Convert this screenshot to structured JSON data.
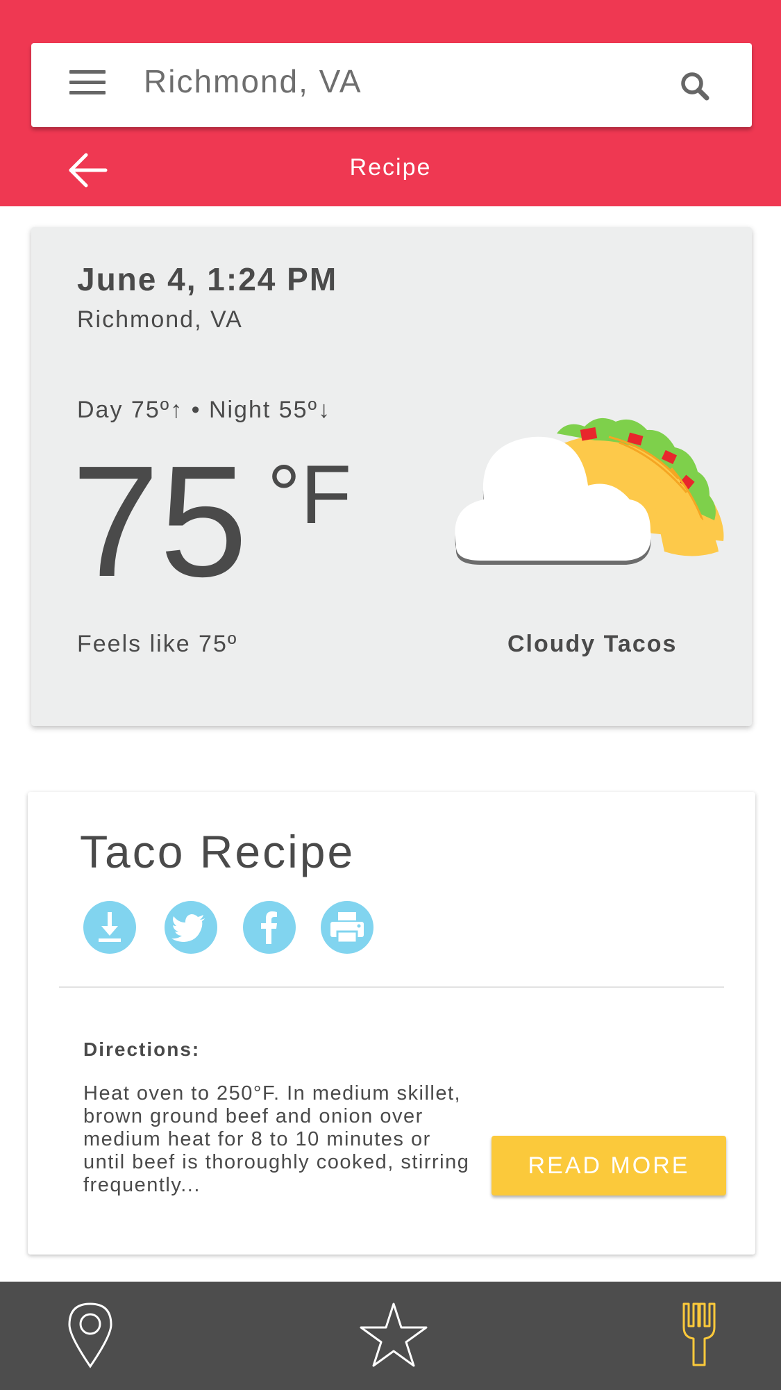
{
  "header": {
    "search_value": "Richmond, VA",
    "title": "Recipe",
    "background_color": "#ef3852",
    "icons": {
      "menu": "menu-icon",
      "search": "search-icon",
      "back": "back-arrow-icon"
    }
  },
  "weather": {
    "datetime": "June 4, 1:24 PM",
    "location": "Richmond, VA",
    "day_night": "Day 75º↑ • Night 55º↓",
    "temperature": "75",
    "unit": "°F",
    "feels_like": "Feels like 75º",
    "condition": "Cloudy Tacos",
    "illustration": "cloudy-taco-icon"
  },
  "recipe": {
    "title": "Taco Recipe",
    "share_buttons": [
      {
        "name": "download",
        "icon": "download-icon"
      },
      {
        "name": "twitter",
        "icon": "twitter-icon"
      },
      {
        "name": "facebook",
        "icon": "facebook-icon"
      },
      {
        "name": "print",
        "icon": "print-icon"
      }
    ],
    "share_color": "#81d4ef",
    "directions_label": "Directions:",
    "directions_text": "Heat oven to 250°F. In medium skillet, brown ground beef and onion over medium heat for 8 to 10 minutes or until beef is thoroughly cooked, stirring frequently...",
    "read_more_label": "READ MORE",
    "read_more_color": "#fbc93b"
  },
  "bottom_nav": {
    "items": [
      {
        "name": "location",
        "icon": "map-pin-icon",
        "active": false
      },
      {
        "name": "favorites",
        "icon": "star-icon",
        "active": false
      },
      {
        "name": "recipes",
        "icon": "fork-icon",
        "active": true
      }
    ],
    "background_color": "#4d4d4d",
    "active_color": "#fbc93b"
  }
}
